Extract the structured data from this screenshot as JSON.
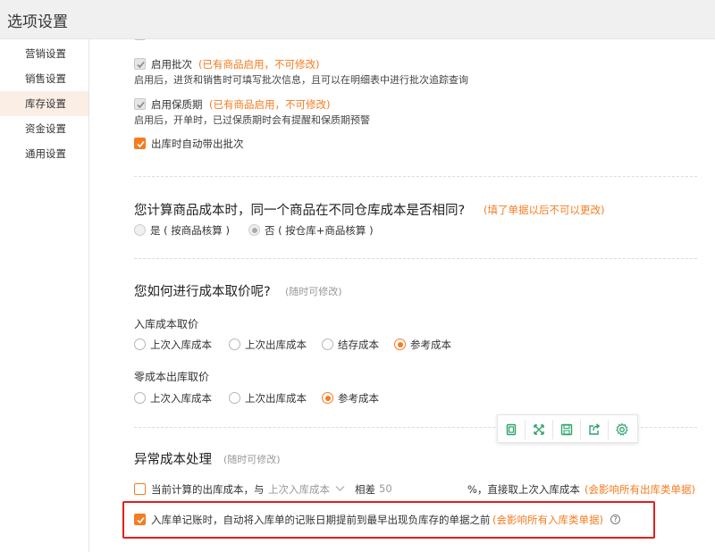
{
  "window": {
    "title": "选项设置"
  },
  "sidebar": {
    "items": [
      {
        "label": "营销设置"
      },
      {
        "label": "销售设置"
      },
      {
        "label": "库存设置",
        "active": true
      },
      {
        "label": "资金设置"
      },
      {
        "label": "通用设置"
      }
    ]
  },
  "batch": {
    "label": "启用批次",
    "note": "(已有商品启用，不可修改)",
    "desc": "启用后，进货和销售时可填写批次信息，且可以在明细表中进行批次追踪查询"
  },
  "shelf_life": {
    "label": "启用保质期",
    "note": "(已有商品启用，不可修改)",
    "desc": "启用后，开单时，已过保质期时会有提醒和保质期预警"
  },
  "auto_batch": {
    "label": "出库时自动带出批次"
  },
  "cost_same": {
    "question": "您计算商品成本时，同一个商品在不同仓库成本是否相同?",
    "note": "(填了单据以后不可以更改)",
    "options": [
      "是 ( 按商品核算 )",
      "否 ( 按仓库+商品核算 )"
    ]
  },
  "cost_method": {
    "question": "您如何进行成本取价呢?",
    "hint": "(随时可修改)",
    "inbound_title": "入库成本取价",
    "inbound_options": [
      "上次入库成本",
      "上次出库成本",
      "结存成本",
      "参考成本"
    ],
    "zero_title": "零成本出库取价",
    "zero_options": [
      "上次入库成本",
      "上次出库成本",
      "参考成本"
    ]
  },
  "abnormal": {
    "title": "异常成本处理",
    "hint": "(随时可修改)",
    "row1_prefix": "当前计算的出库成本，与",
    "row1_select": "上次入库成本",
    "row1_diff": "相差",
    "row1_value": "50",
    "row1_suffix": "%，直接取上次入库成本",
    "row1_note": "(会影响所有出库类单据)",
    "row2_label": "入库单记账时，自动将入库单的记账日期提前到最早出现负库存的单据之前",
    "row2_note": "(会影响所有入库类单据)",
    "help": "?"
  },
  "colors": {
    "accent": "#f57c20",
    "highlight": "#e51d1d"
  }
}
